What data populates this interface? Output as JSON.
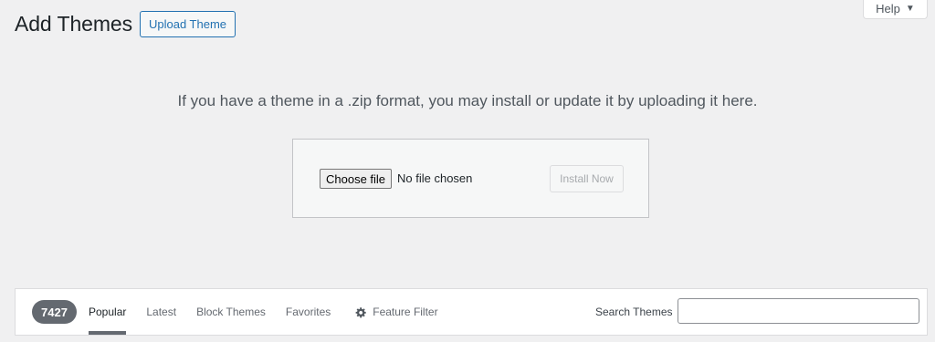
{
  "help": {
    "label": "Help",
    "caret": "▼"
  },
  "header": {
    "title": "Add Themes",
    "upload_button": "Upload Theme"
  },
  "upload": {
    "help_text": "If you have a theme in a .zip format, you may install or update it by uploading it here.",
    "choose_file_label": "Choose file",
    "file_status": "No file chosen",
    "install_button": "Install Now"
  },
  "filter_bar": {
    "count": "7427",
    "links": [
      {
        "label": "Popular",
        "active": true
      },
      {
        "label": "Latest"
      },
      {
        "label": "Block Themes"
      },
      {
        "label": "Favorites"
      }
    ],
    "feature_filter": {
      "label": "Feature Filter",
      "icon": "gear-icon"
    },
    "search_label": "Search Themes",
    "search_value": "",
    "search_placeholder": ""
  },
  "colors": {
    "background": "#f0f0f1",
    "accent": "#2271b1",
    "badge": "#646970"
  }
}
